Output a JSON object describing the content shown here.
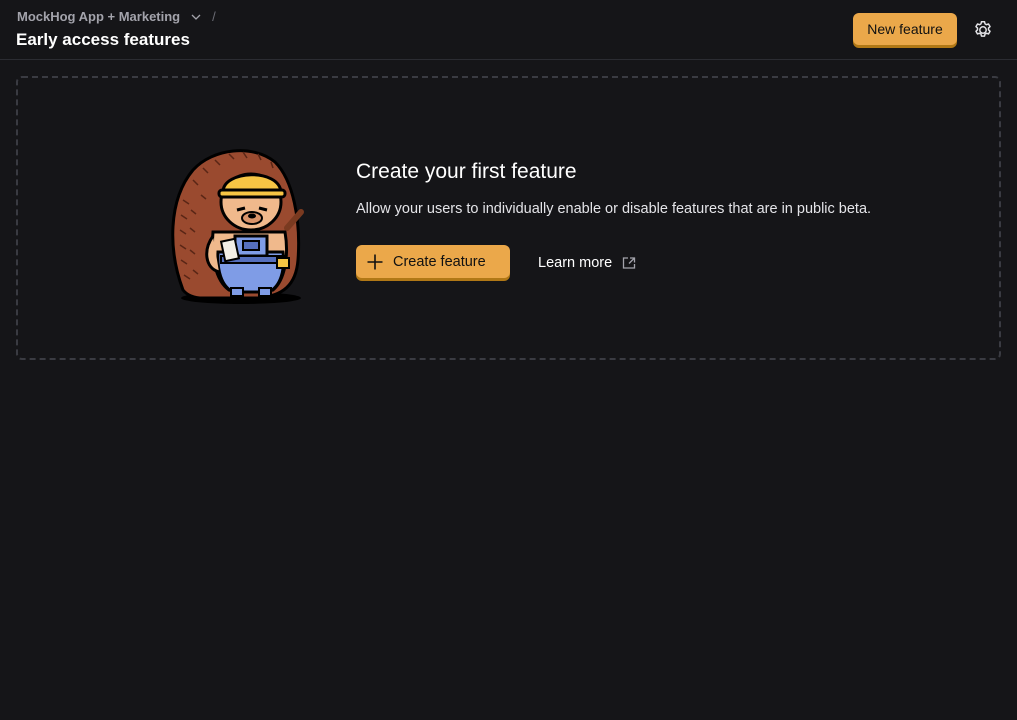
{
  "header": {
    "project_name": "MockHog App + Marketing",
    "separator": "/",
    "page_title": "Early access features",
    "new_feature_label": "New feature"
  },
  "empty_state": {
    "title": "Create your first feature",
    "description": "Allow your users to individually enable or disable features that are in public beta.",
    "create_button_label": "Create feature",
    "learn_more_label": "Learn more"
  },
  "icons": {
    "project_switcher": "chevron-down-icon",
    "settings": "gear-icon",
    "create": "plus-icon",
    "external": "external-link-icon"
  },
  "colors": {
    "background": "#151518",
    "accent": "#eba84a",
    "accent_shadow": "#b17816",
    "border": "#3a3b42"
  }
}
